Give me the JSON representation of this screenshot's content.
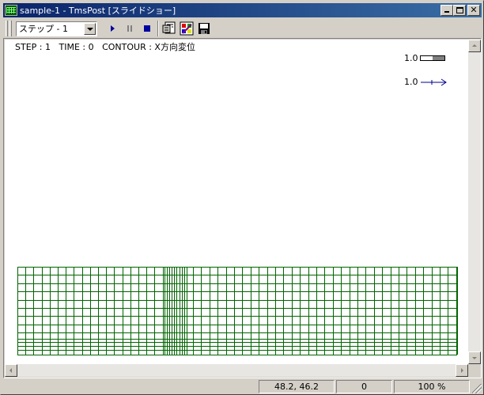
{
  "window": {
    "title": "sample-1 - TmsPost [スライドショー]",
    "minimize_label": "minimize",
    "maximize_label": "maximize",
    "close_label": "close"
  },
  "toolbar": {
    "step_select_value": "ステップ - 1",
    "buttons": [
      {
        "name": "play-button",
        "icon": "play-icon"
      },
      {
        "name": "pause-button",
        "icon": "pause-icon"
      },
      {
        "name": "stop-button",
        "icon": "stop-icon"
      },
      {
        "name": "properties-button",
        "icon": "properties-icon"
      },
      {
        "name": "color-palette-button",
        "icon": "palette-icon"
      },
      {
        "name": "save-button",
        "icon": "floppy-disk-icon"
      }
    ]
  },
  "canvas": {
    "step": "STEP : 1",
    "time": "TIME : 0",
    "contour": "CONTOUR : X方向変位",
    "legend_scale_value": "1.0",
    "legend_vector_value": "1.0",
    "mesh_color": "#006400",
    "vector_color": "#00008b"
  },
  "status": {
    "coords": "48.2, 46.2",
    "value": "0",
    "zoom": "100 %"
  }
}
